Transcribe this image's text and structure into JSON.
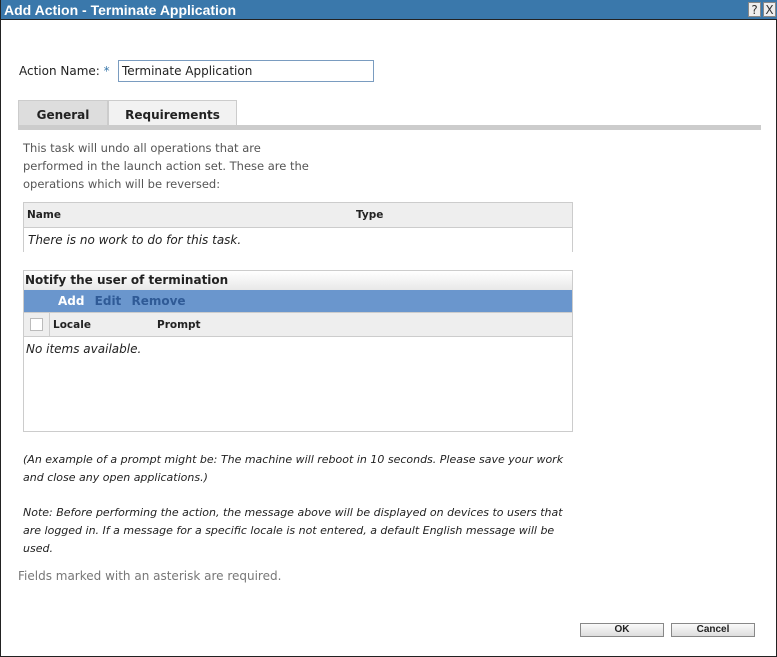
{
  "window": {
    "title": "Add Action - Terminate Application",
    "help": "?",
    "close": "X"
  },
  "form": {
    "action_name_label": "Action Name:",
    "required_mark": "*",
    "action_name_value": "Terminate Application"
  },
  "tabs": [
    {
      "label": "General"
    },
    {
      "label": "Requirements"
    }
  ],
  "general": {
    "description": "This task will undo all operations that are performed in the launch action set. These are the operations which will be reversed:",
    "ops_table": {
      "columns": [
        "Name",
        "Type"
      ],
      "empty": "There is no work to do for this task."
    },
    "notify": {
      "title": "Notify the user of termination",
      "actions": [
        "Add",
        "Edit",
        "Remove"
      ],
      "columns": [
        "Locale",
        "Prompt"
      ],
      "empty": "No items available."
    },
    "example": "(An example of a prompt might be: The machine will reboot in 10 seconds. Please save your work and close any open applications.)",
    "note": "Note: Before performing the action, the message above will be displayed on devices to users that are logged in. If a message for a specific locale is not entered, a default English message will be used."
  },
  "footer": {
    "required_note": "Fields marked with an asterisk are required.",
    "ok": "OK",
    "cancel": "Cancel"
  }
}
